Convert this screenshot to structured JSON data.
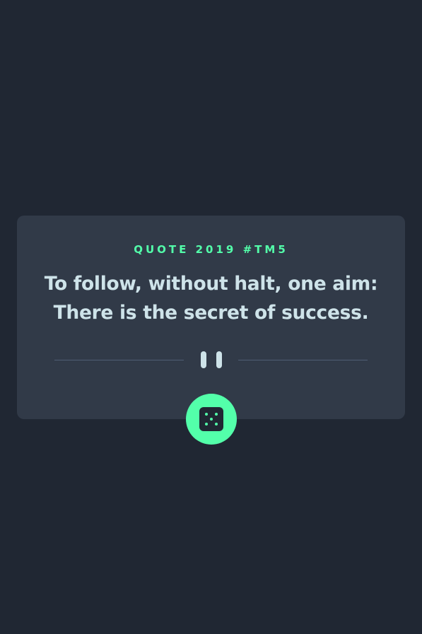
{
  "advice": {
    "label": "QUOTE 2019 #TM5",
    "text": "To follow, without halt, one aim: There is the secret of success."
  },
  "dice_button": {
    "icon": "dice-five-icon",
    "accent_color": "#53ffaa"
  },
  "divider": {
    "icon": "pause-icon"
  },
  "colors": {
    "background": "#202733",
    "card": "#313a48",
    "text": "#cee3e9",
    "divider_line": "#4f5d74"
  }
}
